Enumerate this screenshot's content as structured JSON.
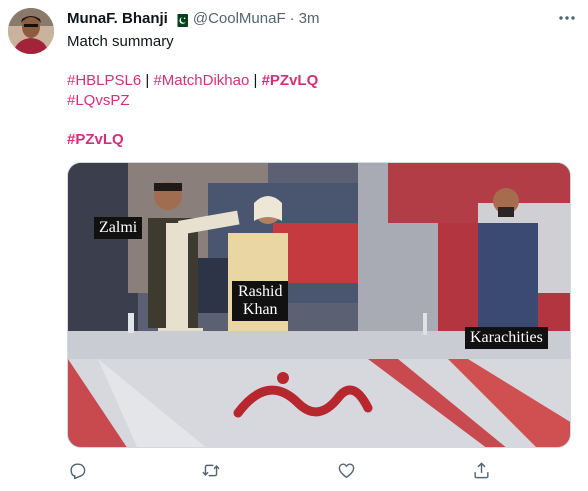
{
  "tweet": {
    "author_name": "MunaF. Bhanji",
    "handle": "@CoolMunaF",
    "separator": "·",
    "time": "3m",
    "flag_icon": "pakistan-flag-icon",
    "line1": "Match summary",
    "hashtags_line2": [
      {
        "text": "#HBLPSL6",
        "bold": false
      },
      {
        "text": "#MatchDikhao",
        "bold": false
      },
      {
        "text": "#PZvLQ",
        "bold": true
      }
    ],
    "line2_separator": " | ",
    "hashtags_line3": [
      "#LQvsPZ"
    ],
    "hashtag_line4": "#PZvLQ"
  },
  "media": {
    "captions": {
      "left": "Zalmi",
      "center": [
        "Rashid",
        "Khan"
      ],
      "right": "Karachities"
    }
  },
  "actions": [
    {
      "name": "reply-icon"
    },
    {
      "name": "retweet-icon"
    },
    {
      "name": "like-icon"
    },
    {
      "name": "share-icon"
    }
  ],
  "colors": {
    "hashtag": "#d4307a",
    "text": "#0f1419",
    "secondary": "#536471",
    "border": "#cfd9de"
  }
}
